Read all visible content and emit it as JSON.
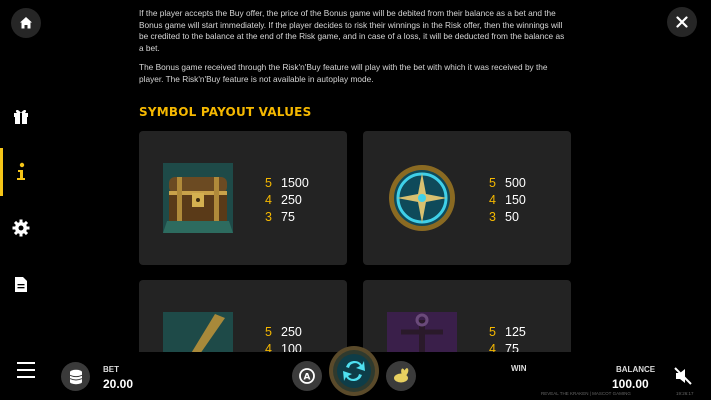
{
  "info": {
    "paragraphs": [
      "If the player accepts the Buy offer, the price of the Bonus game will be debited from their balance as a bet and the Bonus game will start immediately. If the player decides to risk their winnings in the Risk offer, then the winnings will be credited to the balance at the end of the Risk game, and in case of a loss, it will be deducted from the balance as a bet.",
      "The Bonus game received through the Risk'n'Buy feature will play with the bet with which it was received by the player. The Risk'n'Buy feature is not available in autoplay mode."
    ],
    "section_title": "SYMBOL PAYOUT VALUES"
  },
  "symbols": [
    {
      "icon": "treasure-chest-icon",
      "payouts": [
        {
          "count": "5",
          "value": "1500"
        },
        {
          "count": "4",
          "value": "250"
        },
        {
          "count": "3",
          "value": "75"
        }
      ]
    },
    {
      "icon": "compass-icon",
      "payouts": [
        {
          "count": "5",
          "value": "500"
        },
        {
          "count": "4",
          "value": "150"
        },
        {
          "count": "3",
          "value": "50"
        }
      ]
    },
    {
      "icon": "sword-icon",
      "payouts": [
        {
          "count": "5",
          "value": "250"
        },
        {
          "count": "4",
          "value": "100"
        }
      ]
    },
    {
      "icon": "anchor-icon",
      "payouts": [
        {
          "count": "5",
          "value": "125"
        },
        {
          "count": "4",
          "value": "75"
        }
      ]
    }
  ],
  "bottom": {
    "bet_label": "BET",
    "bet_value": "20.00",
    "win_label": "WIN",
    "balance_label": "BALANCE",
    "balance_value": "100.00",
    "game_footer": "REVEAL THE KRAKEN | MASCOT GAMING",
    "time": "19:26:17"
  },
  "colors": {
    "accent": "#f5b800",
    "card_bg": "#232323",
    "background": "#000000"
  }
}
